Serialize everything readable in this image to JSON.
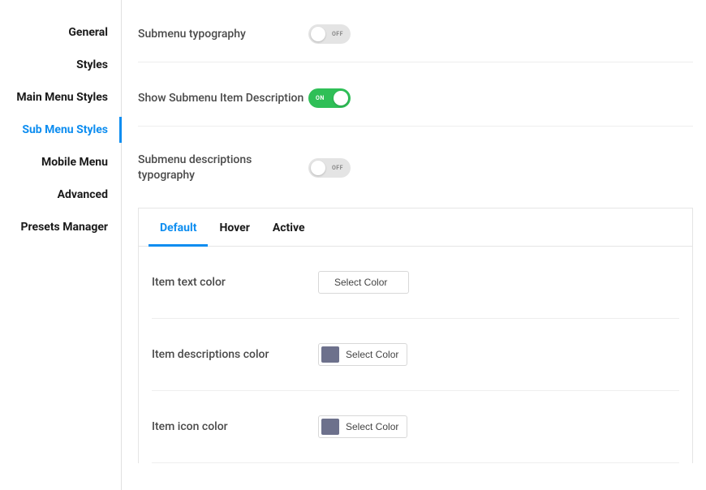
{
  "sidebar": {
    "items": [
      {
        "label": "General"
      },
      {
        "label": "Styles"
      },
      {
        "label": "Main Menu Styles"
      },
      {
        "label": "Sub Menu Styles"
      },
      {
        "label": "Mobile Menu"
      },
      {
        "label": "Advanced"
      },
      {
        "label": "Presets Manager"
      }
    ],
    "active_index": 3
  },
  "settings": {
    "submenu_typography": {
      "label": "Submenu typography",
      "state": "off",
      "state_text": "OFF"
    },
    "show_item_desc": {
      "label": "Show Submenu Item Description",
      "state": "on",
      "state_text": "ON"
    },
    "desc_typography": {
      "label": "Submenu descriptions typography",
      "state": "off",
      "state_text": "OFF"
    }
  },
  "tabs": {
    "items": [
      {
        "label": "Default"
      },
      {
        "label": "Hover"
      },
      {
        "label": "Active"
      }
    ],
    "active_index": 0
  },
  "color_rows": {
    "item_text": {
      "label": "Item text color",
      "button": "Select Color",
      "swatch": null
    },
    "item_desc": {
      "label": "Item descriptions color",
      "button": "Select Color",
      "swatch": "#6d718c"
    },
    "item_icon": {
      "label": "Item icon color",
      "button": "Select Color",
      "swatch": "#6d718c"
    }
  }
}
